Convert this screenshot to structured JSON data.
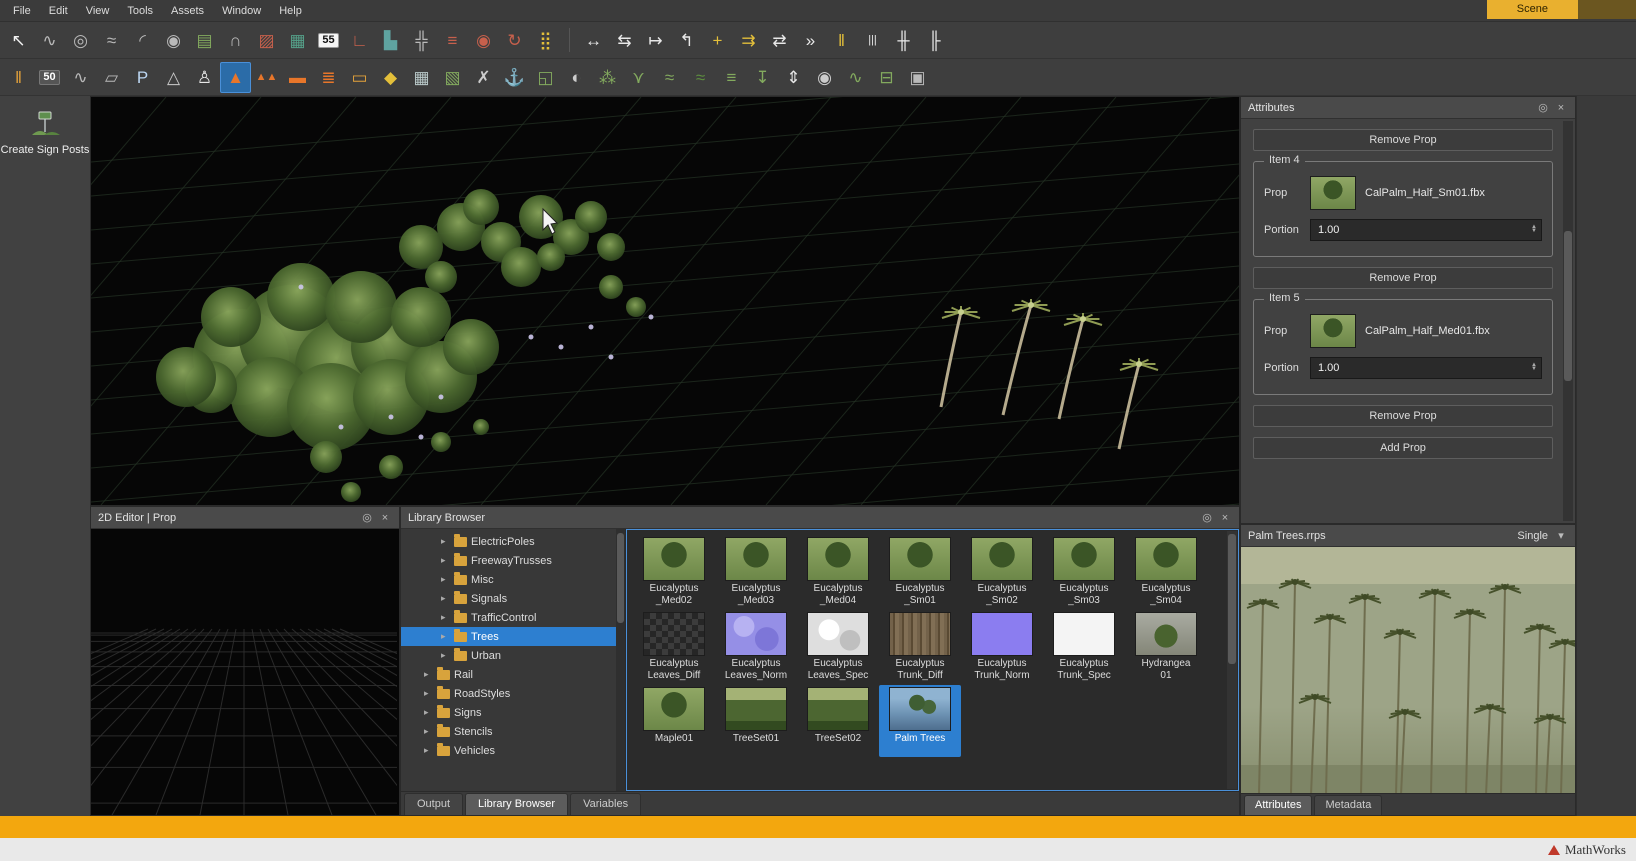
{
  "app": {
    "scene_tab": "Scene"
  },
  "menu": {
    "items": [
      "File",
      "Edit",
      "View",
      "Tools",
      "Assets",
      "Window",
      "Help"
    ]
  },
  "icons": {
    "settings": "◎",
    "close": "×",
    "spin_up": "▲",
    "spin_down": "▼",
    "expand_arrow": "▸",
    "dropdown": "▾",
    "folder_color": "#d8a33c",
    "selection_blue": "#2d7fd0",
    "accent_orange": "#f3a70e"
  },
  "toolbars": {
    "row1": [
      {
        "name": "select-tool",
        "glyph": "↖",
        "color": "#f2f2f2"
      },
      {
        "name": "tangent-curve-tool",
        "glyph": "∿",
        "color": "#b9b9b9"
      },
      {
        "name": "circle-curve-tool",
        "glyph": "◎",
        "color": "#b9b9b9"
      },
      {
        "name": "freeform-curve-tool",
        "glyph": "≈",
        "color": "#b9b9b9"
      },
      {
        "name": "arc-curve-tool",
        "glyph": "◜",
        "color": "#b9b9b9"
      },
      {
        "name": "spiral-curve-tool",
        "glyph": "◉",
        "color": "#b9b9b9"
      },
      {
        "name": "road-plan-tool",
        "glyph": "▤",
        "color": "#83aa5e"
      },
      {
        "name": "bridge-span-tool",
        "glyph": "∩",
        "color": "#b9b9b9"
      },
      {
        "name": "road-surface-tool",
        "glyph": "▨",
        "color": "#c7604c"
      },
      {
        "name": "crosswalk-surface-tool",
        "glyph": "▦",
        "color": "#55a089"
      },
      {
        "name": "speed-limit-sign-tool",
        "glyph": "55",
        "boxed": "light"
      },
      {
        "name": "corner-apex-tool",
        "glyph": "∟",
        "color": "#c7604c"
      },
      {
        "name": "city-layout-tool",
        "glyph": "▙",
        "color": "#5fa3a0"
      },
      {
        "name": "intersection-tool",
        "glyph": "╬",
        "color": "#b9b9b9"
      },
      {
        "name": "marking-lines-tool",
        "glyph": "≡",
        "color": "#c7604c"
      },
      {
        "name": "roundabout-tool",
        "glyph": "◉",
        "color": "#c7604c"
      },
      {
        "name": "ramp-curve-tool",
        "glyph": "↻",
        "color": "#c7604c"
      },
      {
        "name": "traffic-signal-tool",
        "glyph": "⣿",
        "color": "#e3bf3a"
      },
      {
        "sep": true
      },
      {
        "name": "lane-width-tool",
        "glyph": "↔",
        "color": "#e8e8e8"
      },
      {
        "name": "lane-offset-tool",
        "glyph": "⇆",
        "color": "#e8e8e8"
      },
      {
        "name": "lane-extend-tool",
        "glyph": "↦",
        "color": "#e8e8e8"
      },
      {
        "name": "lane-handle-tool",
        "glyph": "↰",
        "color": "#e8e8e8"
      },
      {
        "name": "lane-cross-tool",
        "glyph": "+",
        "color": "#e3bf3a"
      },
      {
        "name": "lane-add-tool",
        "glyph": "⇉",
        "color": "#e3bf3a"
      },
      {
        "name": "lane-shift-tool",
        "glyph": "⇄",
        "color": "#e8e8e8"
      },
      {
        "name": "lane-chevron-tool",
        "glyph": "»",
        "color": "#e8e8e8"
      },
      {
        "name": "lane-double-marking-tool",
        "glyph": "‖",
        "color": "#e3bf3a"
      },
      {
        "name": "lane-triple-marking-tool",
        "glyph": "|||",
        "color": "#e8e8e8"
      },
      {
        "name": "lane-connect-tool",
        "glyph": "╫",
        "color": "#e8e8e8"
      },
      {
        "name": "lane-node-tool",
        "glyph": "╟",
        "color": "#e8e8e8"
      }
    ],
    "row2": [
      {
        "name": "road-marking-paint-tool",
        "glyph": "‖",
        "color": "#e3a23b"
      },
      {
        "name": "speed-paint-tool",
        "glyph": "50",
        "boxed": "dark"
      },
      {
        "name": "marking-curve-tool",
        "glyph": "∿",
        "color": "#b9b9b9"
      },
      {
        "name": "surface-polygon-tool",
        "glyph": "▱",
        "color": "#b9b9b9"
      },
      {
        "name": "parking-tool",
        "glyph": "P",
        "color": "#bcd6f2"
      },
      {
        "name": "yield-marking-tool",
        "glyph": "△",
        "color": "#cccccc"
      },
      {
        "name": "pedestrian-tool",
        "glyph": "♙",
        "color": "#e8e8e8"
      },
      {
        "name": "cone-tool",
        "glyph": "▲",
        "color": "#e8762a",
        "selected": true
      },
      {
        "name": "cone-row-tool",
        "glyph": "▲▲",
        "color": "#e8762a"
      },
      {
        "name": "barricade-tool",
        "glyph": "▬",
        "color": "#e8762a"
      },
      {
        "name": "barrel-row-tool",
        "glyph": "≣",
        "color": "#e8762a"
      },
      {
        "name": "guardrail-tool",
        "glyph": "▭",
        "color": "#e3a23b"
      },
      {
        "name": "warning-sign-tool",
        "glyph": "◆",
        "color": "#e3bf3a"
      },
      {
        "name": "building-tool",
        "glyph": "▦",
        "color": "#b9c9c9"
      },
      {
        "name": "terrain-tool",
        "glyph": "▧",
        "color": "#83aa5e"
      },
      {
        "name": "prop-tools-tool",
        "glyph": "✗",
        "color": "#cccccc"
      },
      {
        "name": "anchor-tool",
        "glyph": "⚓",
        "color": "#d8d8d8"
      },
      {
        "name": "region-frame-tool",
        "glyph": "◱",
        "color": "#83aa5e"
      },
      {
        "name": "satellite-image-tool",
        "glyph": "◐",
        "color": "#cccccc"
      },
      {
        "name": "vegetation-tool",
        "glyph": "⁂",
        "color": "#83aa5e"
      },
      {
        "name": "network-branch-tool",
        "glyph": "⋎",
        "color": "#83aa5e"
      },
      {
        "name": "road-layers-tool",
        "glyph": "≈",
        "color": "#83aa5e"
      },
      {
        "name": "elevation-layers-tool",
        "glyph": "≈",
        "color": "#5d8f3e"
      },
      {
        "name": "stack-layers-tool",
        "glyph": "≡",
        "color": "#83aa5e"
      },
      {
        "name": "geo-pin-tool",
        "glyph": "↧",
        "color": "#83aa5e"
      },
      {
        "name": "measure-tool",
        "glyph": "⇕",
        "color": "#e8e8e8"
      },
      {
        "name": "camera-tool",
        "glyph": "◉",
        "color": "#cccccc"
      },
      {
        "name": "road-preview-tool",
        "glyph": "∿",
        "color": "#83aa5e"
      },
      {
        "name": "export-scene-tool",
        "glyph": "⊟",
        "color": "#83aa5e"
      },
      {
        "name": "duplicate-view-tool",
        "glyph": "▣",
        "color": "#b9b9b9"
      }
    ]
  },
  "left_tool": {
    "label": "Create Sign Posts"
  },
  "panels": {
    "editor2d": {
      "title": "2D Editor | Prop"
    },
    "library": {
      "title": "Library Browser",
      "tree": [
        {
          "label": "ElectricPoles",
          "depth": 2
        },
        {
          "label": "FreewayTrusses",
          "depth": 2
        },
        {
          "label": "Misc",
          "depth": 2
        },
        {
          "label": "Signals",
          "depth": 2
        },
        {
          "label": "TrafficControl",
          "depth": 2
        },
        {
          "label": "Trees",
          "depth": 2,
          "selected": true
        },
        {
          "label": "Urban",
          "depth": 2
        },
        {
          "label": "Rail",
          "depth": 1
        },
        {
          "label": "RoadStyles",
          "depth": 1
        },
        {
          "label": "Signs",
          "depth": 1
        },
        {
          "label": "Stencils",
          "depth": 1
        },
        {
          "label": "Vehicles",
          "depth": 1
        }
      ],
      "assets": [
        {
          "label": "Eucalyptus\n_Med02",
          "thumb": "tree"
        },
        {
          "label": "Eucalyptus\n_Med03",
          "thumb": "tree"
        },
        {
          "label": "Eucalyptus\n_Med04",
          "thumb": "tree"
        },
        {
          "label": "Eucalyptus\n_Sm01",
          "thumb": "tree"
        },
        {
          "label": "Eucalyptus\n_Sm02",
          "thumb": "tree"
        },
        {
          "label": "Eucalyptus\n_Sm03",
          "thumb": "tree"
        },
        {
          "label": "Eucalyptus\n_Sm04",
          "thumb": "tree"
        },
        {
          "label": "Eucalyptus\nLeaves_Diff",
          "thumb": "checker"
        },
        {
          "label": "Eucalyptus\nLeaves_Norm",
          "thumb": "norm-mottled"
        },
        {
          "label": "Eucalyptus\nLeaves_Spec",
          "thumb": "spec-mottled"
        },
        {
          "label": "Eucalyptus\nTrunk_Diff",
          "thumb": "bark"
        },
        {
          "label": "Eucalyptus\nTrunk_Norm",
          "thumb": "norm-solid"
        },
        {
          "label": "Eucalyptus\nTrunk_Spec",
          "thumb": "spec-solid"
        },
        {
          "label": "Hydrangea\n01",
          "thumb": "hydrangea"
        },
        {
          "label": "Maple01",
          "thumb": "tree"
        },
        {
          "label": "TreeSet01",
          "thumb": "forest"
        },
        {
          "label": "TreeSet02",
          "thumb": "forest"
        },
        {
          "label": "Palm Trees",
          "thumb": "palms",
          "selected": true
        }
      ],
      "tabs": [
        {
          "label": "Output"
        },
        {
          "label": "Library Browser",
          "active": true
        },
        {
          "label": "Variables"
        }
      ]
    },
    "attributes": {
      "title": "Attributes",
      "remove_top": "Remove Prop",
      "items": [
        {
          "name": "Item 4",
          "prop_label": "Prop",
          "file": "CalPalm_Half_Sm01.fbx",
          "portion_label": "Portion",
          "portion": "1.00",
          "remove": "Remove Prop"
        },
        {
          "name": "Item 5",
          "prop_label": "Prop",
          "file": "CalPalm_Half_Med01.fbx",
          "portion_label": "Portion",
          "portion": "1.00",
          "remove": "Remove Prop"
        }
      ],
      "add": "Add Prop"
    },
    "preview": {
      "title": "Palm Trees.rrps",
      "mode": "Single",
      "tabs": [
        {
          "label": "Attributes",
          "active": true
        },
        {
          "label": "Metadata"
        }
      ]
    }
  },
  "footer": {
    "brand": "MathWorks"
  }
}
